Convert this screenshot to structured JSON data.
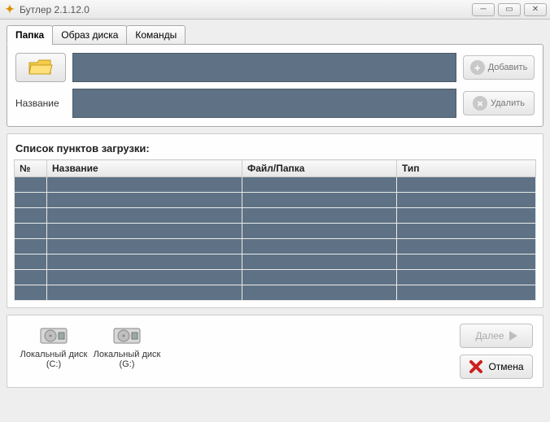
{
  "window": {
    "title": "Бутлер 2.1.12.0"
  },
  "tabs": {
    "folder": "Папка",
    "image": "Образ диска",
    "commands": "Команды"
  },
  "form": {
    "name_label": "Название",
    "add_label": "Добавить",
    "delete_label": "Удалить"
  },
  "list": {
    "title": "Список пунктов загрузки:",
    "headers": {
      "num": "№",
      "name": "Название",
      "file": "Файл/Папка",
      "type": "Тип"
    }
  },
  "disks": [
    {
      "label": "Локальный диск (C:)"
    },
    {
      "label": "Локальный диск (G:)"
    }
  ],
  "nav": {
    "next": "Далее",
    "cancel": "Отмена"
  }
}
